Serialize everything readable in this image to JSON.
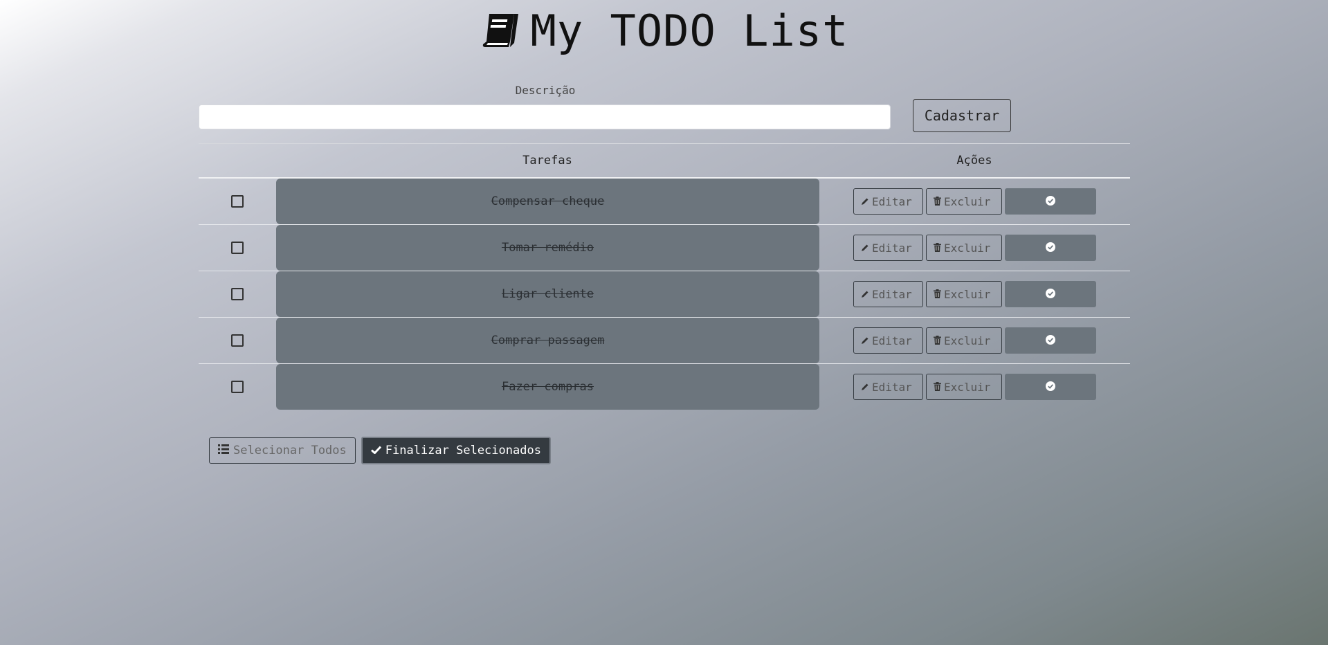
{
  "header": {
    "title": "My TODO List",
    "icon": "book-icon"
  },
  "form": {
    "label": "Descrição",
    "input_value": "",
    "submit_label": "Cadastrar"
  },
  "table": {
    "columns": [
      "",
      "Tarefas",
      "Ações"
    ],
    "rows": [
      {
        "task": "Compensar cheque",
        "edit": "Editar",
        "delete": "Excluir",
        "completed": true,
        "selected": false
      },
      {
        "task": "Tomar remédio",
        "edit": "Editar",
        "delete": "Excluir",
        "completed": true,
        "selected": false
      },
      {
        "task": "Ligar cliente",
        "edit": "Editar",
        "delete": "Excluir",
        "completed": true,
        "selected": false
      },
      {
        "task": "Comprar passagem",
        "edit": "Editar",
        "delete": "Excluir",
        "completed": true,
        "selected": false
      },
      {
        "task": "Fazer compras",
        "edit": "Editar",
        "delete": "Excluir",
        "completed": true,
        "selected": false
      }
    ]
  },
  "footer": {
    "select_all_label": "Selecionar Todos",
    "finish_selected_label": "Finalizar Selecionados"
  },
  "colors": {
    "task_bg": "#6c757d",
    "dark_button": "#343a40"
  }
}
